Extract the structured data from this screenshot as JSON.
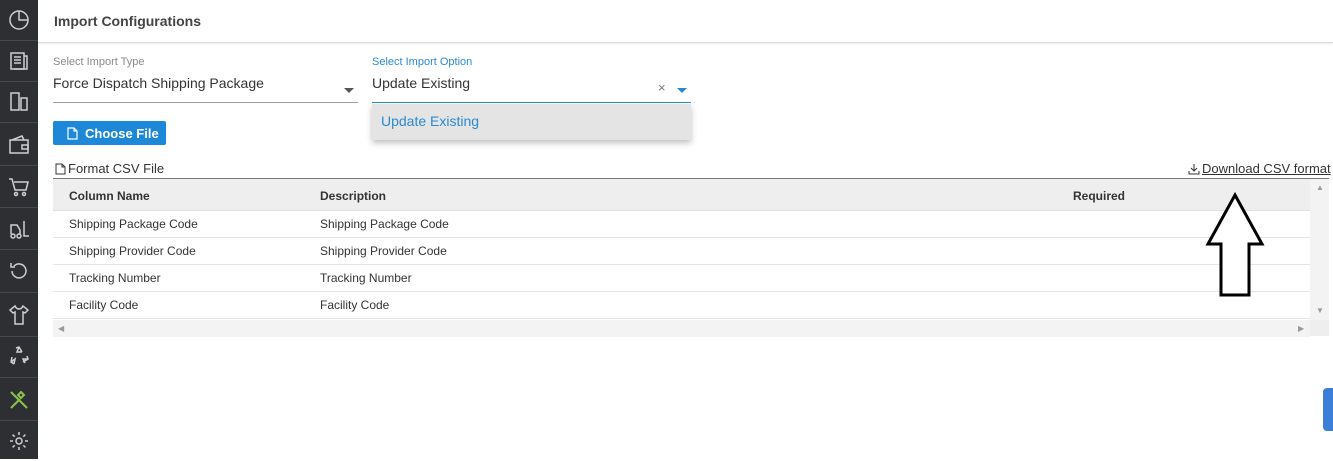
{
  "header": {
    "title": "Import Configurations"
  },
  "sidebar": {
    "items": [
      {
        "icon": "dashboard-icon"
      },
      {
        "icon": "orders-icon"
      },
      {
        "icon": "devices-icon"
      },
      {
        "icon": "wallet-icon"
      },
      {
        "icon": "cart-icon"
      },
      {
        "icon": "forklift-icon"
      },
      {
        "icon": "refresh-icon"
      },
      {
        "icon": "apparel-icon"
      },
      {
        "icon": "recycle-icon"
      },
      {
        "icon": "tools-icon",
        "active": true
      },
      {
        "icon": "settings-icon"
      }
    ],
    "active_color": "#8bc34a"
  },
  "import_type": {
    "label": "Select Import Type",
    "value": "Force Dispatch Shipping Package"
  },
  "import_option": {
    "label": "Select Import Option",
    "value": "Update Existing",
    "clear": "×",
    "options": [
      "Update Existing"
    ]
  },
  "choose_file": {
    "label": "Choose File"
  },
  "format": {
    "label": "Format CSV File",
    "download_label": "Download CSV format"
  },
  "table": {
    "headers": [
      "Column Name",
      "Description",
      "Required"
    ],
    "rows": [
      {
        "name": "Shipping Package Code",
        "description": "Shipping Package Code",
        "required": ""
      },
      {
        "name": "Shipping Provider Code",
        "description": "Shipping Provider Code",
        "required": ""
      },
      {
        "name": "Tracking Number",
        "description": "Tracking Number",
        "required": ""
      },
      {
        "name": "Facility Code",
        "description": "Facility Code",
        "required": ""
      }
    ]
  },
  "colors": {
    "accent": "#2a8ad1",
    "button": "#1e88d8",
    "sidebar": "#2d2f33"
  }
}
